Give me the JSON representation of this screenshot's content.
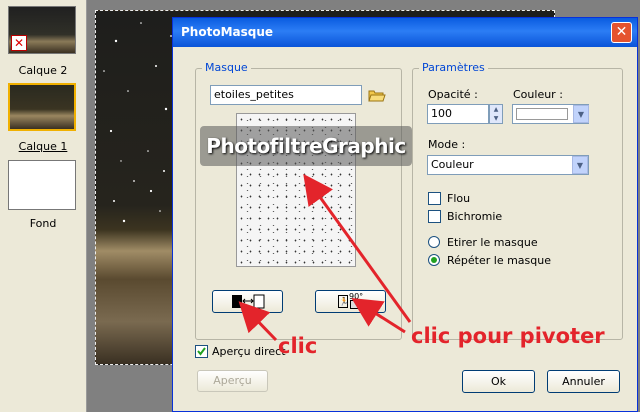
{
  "layers": {
    "items": [
      {
        "label": "Calque 2"
      },
      {
        "label": "Calque 1"
      },
      {
        "label": "Fond"
      }
    ]
  },
  "dialog": {
    "title": "PhotoMasque",
    "close_glyph": "✕",
    "masque": {
      "group_title": "Masque",
      "file_value": "etoiles_petites",
      "watermark": "PhotofiltreGraphic"
    },
    "parametres": {
      "group_title": "Paramètres",
      "opacity_label": "Opacité :",
      "opacity_value": "100",
      "color_label": "Couleur :",
      "color_value": "#ffffff",
      "mode_label": "Mode :",
      "mode_value": "Couleur",
      "flou_label": "Flou",
      "bichromie_label": "Bichromie",
      "etirer_label": "Etirer le masque",
      "repeter_label": "Répéter le masque",
      "selected_option": "repeter"
    },
    "rotate_label": "90°",
    "apercu_direct_label": "Aperçu direct",
    "apercu_button": "Aperçu",
    "ok_button": "Ok",
    "cancel_button": "Annuler"
  },
  "annotations": {
    "clic": "clic",
    "clic_pivoter": "clic pour pivoter",
    "color": "#e3242b"
  }
}
